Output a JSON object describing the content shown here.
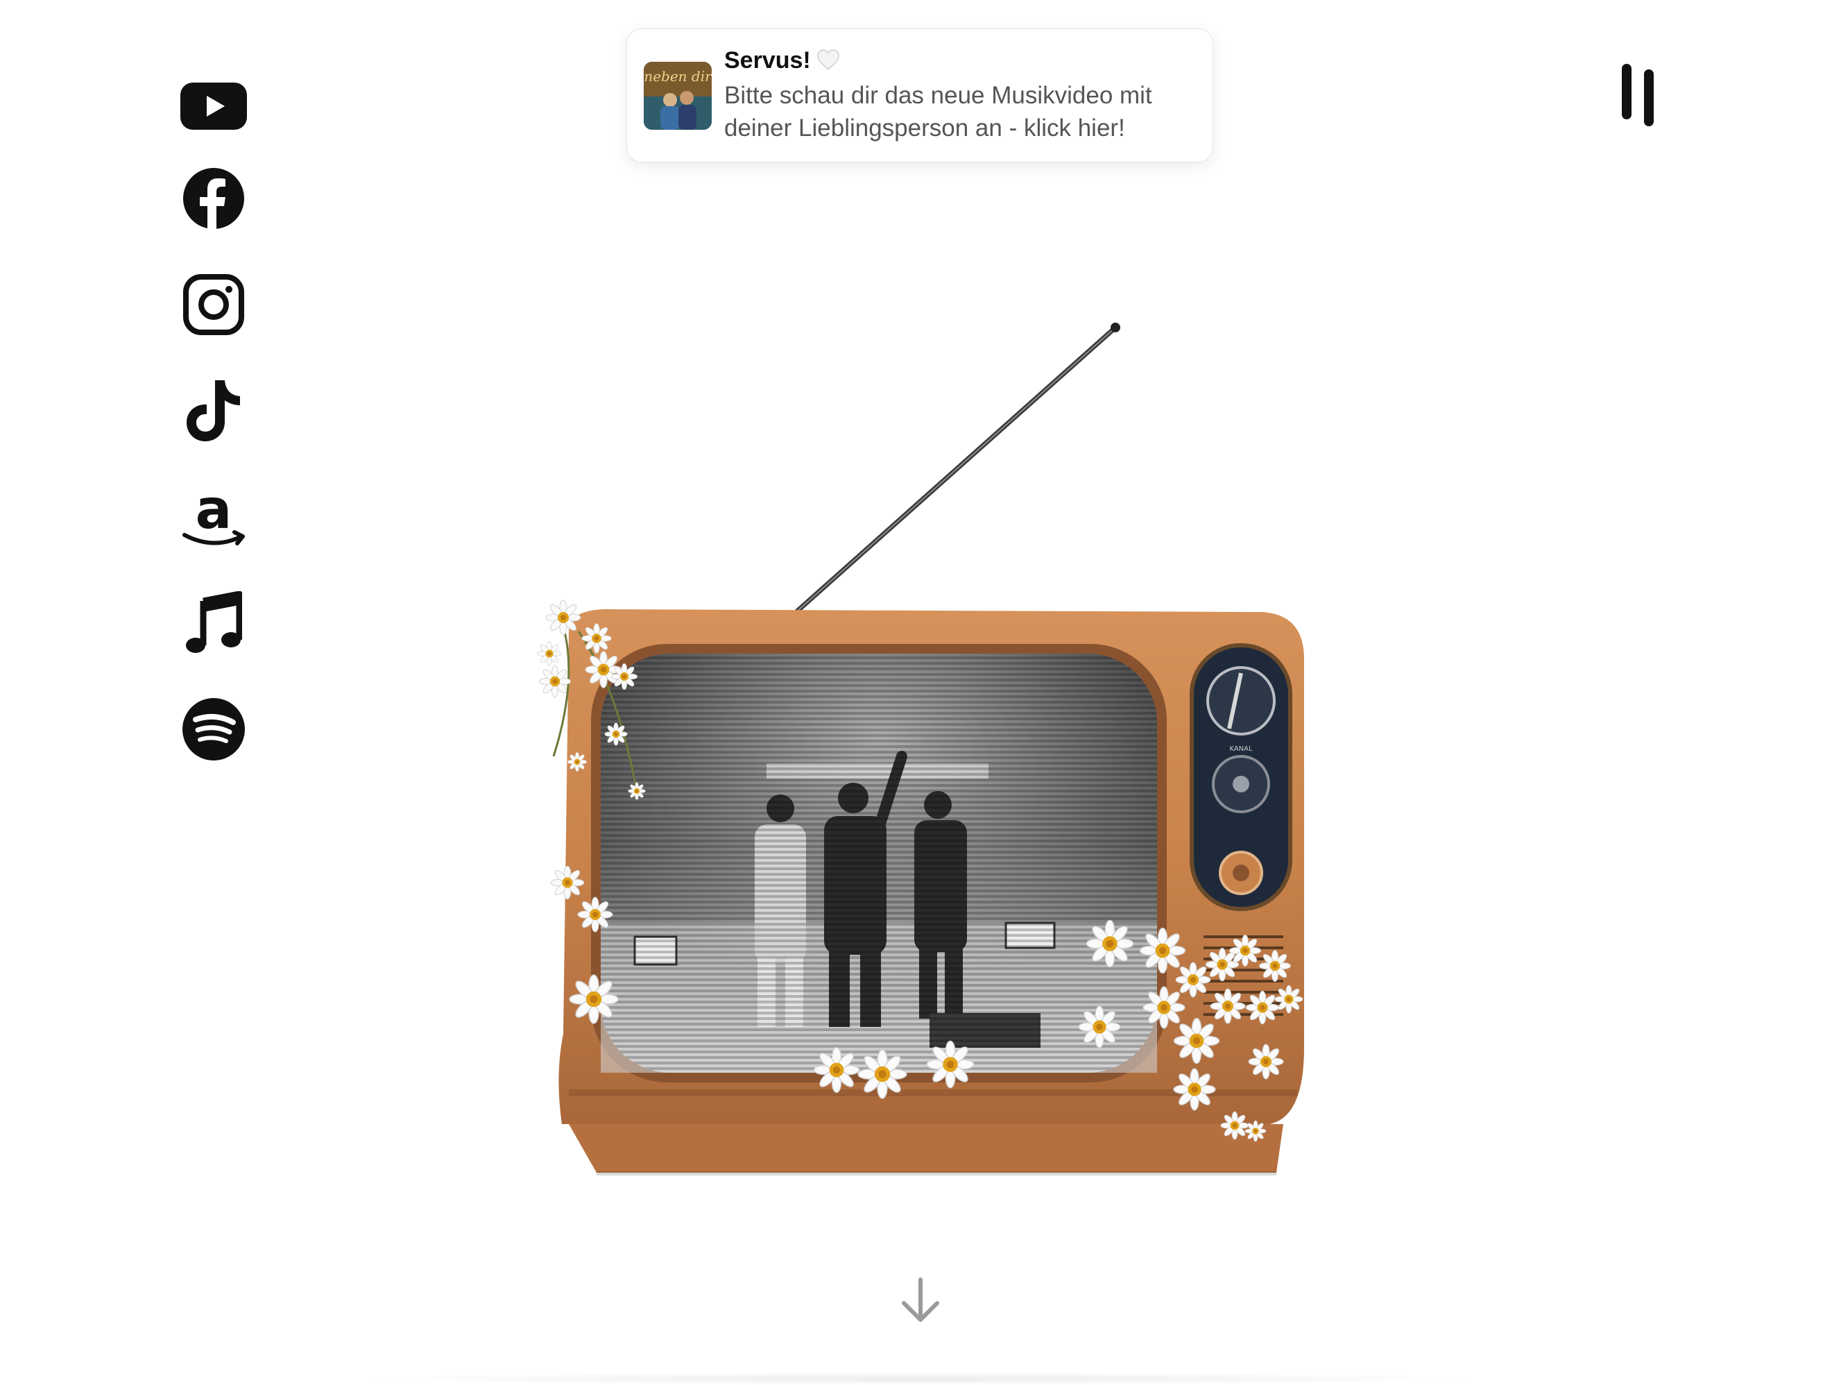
{
  "social": {
    "items": [
      {
        "icon": "youtube-icon"
      },
      {
        "icon": "facebook-icon"
      },
      {
        "icon": "instagram-icon"
      },
      {
        "icon": "tiktok-icon"
      },
      {
        "icon": "amazon-icon"
      },
      {
        "icon": "music-note-icon"
      },
      {
        "icon": "spotify-icon"
      }
    ]
  },
  "notification": {
    "title": "Servus!",
    "heart_icon": "white-heart-icon",
    "body": "Bitte schau dir das neue Musikvideo mit deiner Lieblingsperson an - klick hier!",
    "thumbnail_label": "neben dir"
  },
  "player": {
    "control_icon": "pause-icon"
  },
  "scroll": {
    "icon": "arrow-down-icon"
  },
  "colors": {
    "icon": "#111111",
    "tv_wood": "#c8824a",
    "toast_text": "#555555",
    "arrow": "#9a9a9a"
  }
}
